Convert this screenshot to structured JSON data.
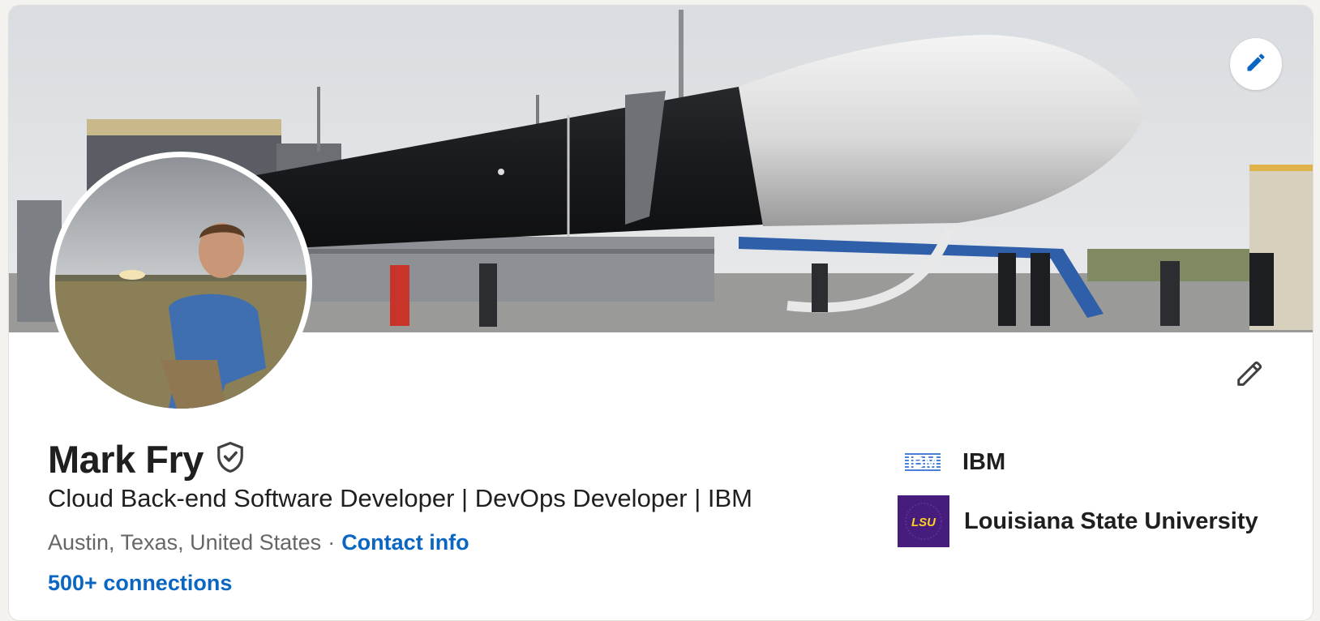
{
  "profile": {
    "name": "Mark Fry",
    "headline": "Cloud Back-end Software Developer | DevOps Developer | IBM",
    "location": "Austin, Texas, United States",
    "separator": "·",
    "contact_label": "Contact info",
    "connections_label": "500+ connections"
  },
  "organizations": [
    {
      "name": "IBM",
      "logo_text": "IBM"
    },
    {
      "name": "Louisiana State University",
      "logo_text": "LSU"
    }
  ],
  "colors": {
    "link": "#0a66c2",
    "lsu_purple": "#461d7c",
    "lsu_gold": "#fdd023",
    "ibm_blue": "#4a7fd6"
  },
  "icons": {
    "cover_edit": "pencil-icon",
    "intro_edit": "pencil-icon",
    "verified": "shield-check-icon"
  }
}
